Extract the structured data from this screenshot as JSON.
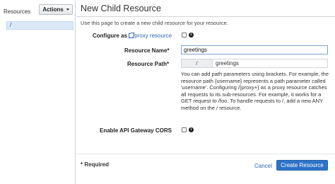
{
  "sidebar": {
    "title": "Resources",
    "actions_label": "Actions",
    "tree": [
      {
        "label": "/"
      }
    ]
  },
  "main": {
    "title": "New Child Resource",
    "intro": "Use this page to create a new child resource for your resource.",
    "configure_label": "Configure as",
    "proxy_link": "proxy resource",
    "resource_name_label": "Resource Name*",
    "resource_name_value": "greetings",
    "resource_path_label": "Resource Path*",
    "resource_path_prefix": "/",
    "resource_path_value": "greetings",
    "help_lines": [
      "You can add path parameters using brackets. For example, the",
      "resource path {username} represents a path parameter called",
      "'username'. Configuring /{proxy+} as a proxy resource catches",
      "all requests to its sub-resources. For example, it works for a",
      "GET request to /foo. To handle requests to /, add a new ANY",
      "method on the / resource."
    ],
    "cors_label": "Enable API Gateway CORS",
    "required_note": "* Required",
    "cancel_label": "Cancel",
    "create_label": "Create Resource"
  }
}
